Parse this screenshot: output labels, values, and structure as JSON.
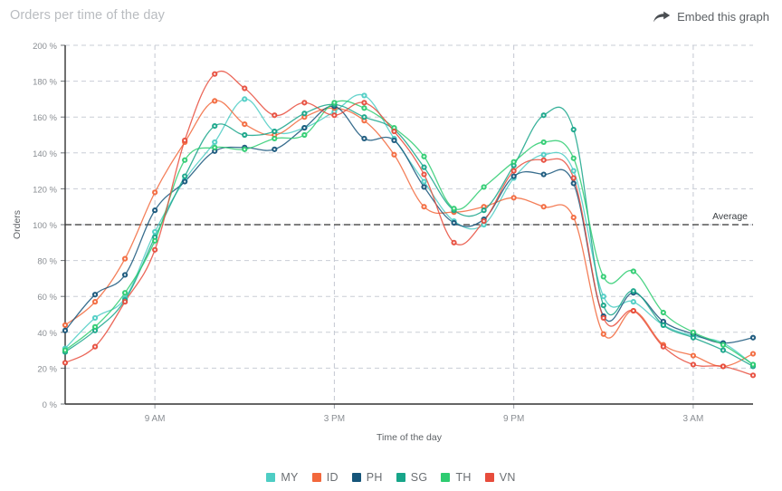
{
  "header": {
    "title": "Orders per time of the day",
    "embed_label": "Embed this graph",
    "embed_icon": "share-arrow-icon"
  },
  "chart_data": {
    "type": "line",
    "title": "Orders per time of the day",
    "xlabel": "Time of the day",
    "ylabel": "Orders",
    "ylim": [
      0,
      200
    ],
    "y_unit": "%",
    "y_ticks": [
      "0 %",
      "20 %",
      "40 %",
      "60 %",
      "80 %",
      "100 %",
      "120 %",
      "140 %",
      "160 %",
      "180 %",
      "200 %"
    ],
    "y_tick_values": [
      0,
      20,
      40,
      60,
      80,
      100,
      120,
      140,
      160,
      180,
      200
    ],
    "x_ticks": [
      "9 AM",
      "3 PM",
      "9 PM",
      "3 AM"
    ],
    "x_tick_hours": [
      9,
      15,
      21,
      27
    ],
    "x": [
      6,
      7,
      8,
      9,
      10,
      11,
      12,
      13,
      14,
      15,
      16,
      17,
      18,
      19,
      20,
      21,
      22,
      23,
      24,
      25,
      26,
      27,
      28,
      29
    ],
    "x_range": [
      6,
      29
    ],
    "grid": true,
    "legend_position": "bottom",
    "annotations": [
      {
        "name": "average-line",
        "label": "Average",
        "value": 100,
        "style": "dashed",
        "color": "#333333"
      }
    ],
    "series": [
      {
        "name": "MY",
        "color": "#4ecdc4",
        "values": [
          31,
          48,
          59,
          96,
          125,
          146,
          170,
          152,
          154,
          163,
          172,
          148,
          124,
          102,
          100,
          126,
          139,
          130,
          60,
          57,
          44,
          38,
          34,
          22
        ]
      },
      {
        "name": "ID",
        "color": "#f2683c",
        "values": [
          44,
          57,
          81,
          118,
          146,
          169,
          156,
          150,
          160,
          165,
          158,
          139,
          110,
          107,
          110,
          115,
          110,
          104,
          39,
          52,
          33,
          27,
          21,
          28
        ]
      },
      {
        "name": "PH",
        "color": "#16557a",
        "values": [
          41,
          61,
          72,
          108,
          124,
          141,
          143,
          142,
          154,
          166,
          148,
          147,
          121,
          101,
          103,
          127,
          128,
          123,
          49,
          62,
          46,
          39,
          34,
          37
        ]
      },
      {
        "name": "SG",
        "color": "#17a589",
        "values": [
          29,
          41,
          58,
          93,
          127,
          155,
          150,
          152,
          162,
          167,
          160,
          153,
          132,
          108,
          108,
          133,
          161,
          153,
          55,
          63,
          44,
          37,
          30,
          21
        ]
      },
      {
        "name": "TH",
        "color": "#2ecc71",
        "values": [
          30,
          43,
          62,
          91,
          136,
          143,
          142,
          148,
          150,
          168,
          165,
          154,
          138,
          109,
          121,
          135,
          146,
          137,
          71,
          74,
          51,
          40,
          33,
          22
        ]
      },
      {
        "name": "VN",
        "color": "#e74c3c",
        "values": [
          23,
          32,
          57,
          86,
          147,
          184,
          176,
          161,
          168,
          161,
          168,
          152,
          128,
          90,
          102,
          130,
          136,
          126,
          48,
          52,
          32,
          22,
          21,
          16
        ]
      }
    ]
  }
}
